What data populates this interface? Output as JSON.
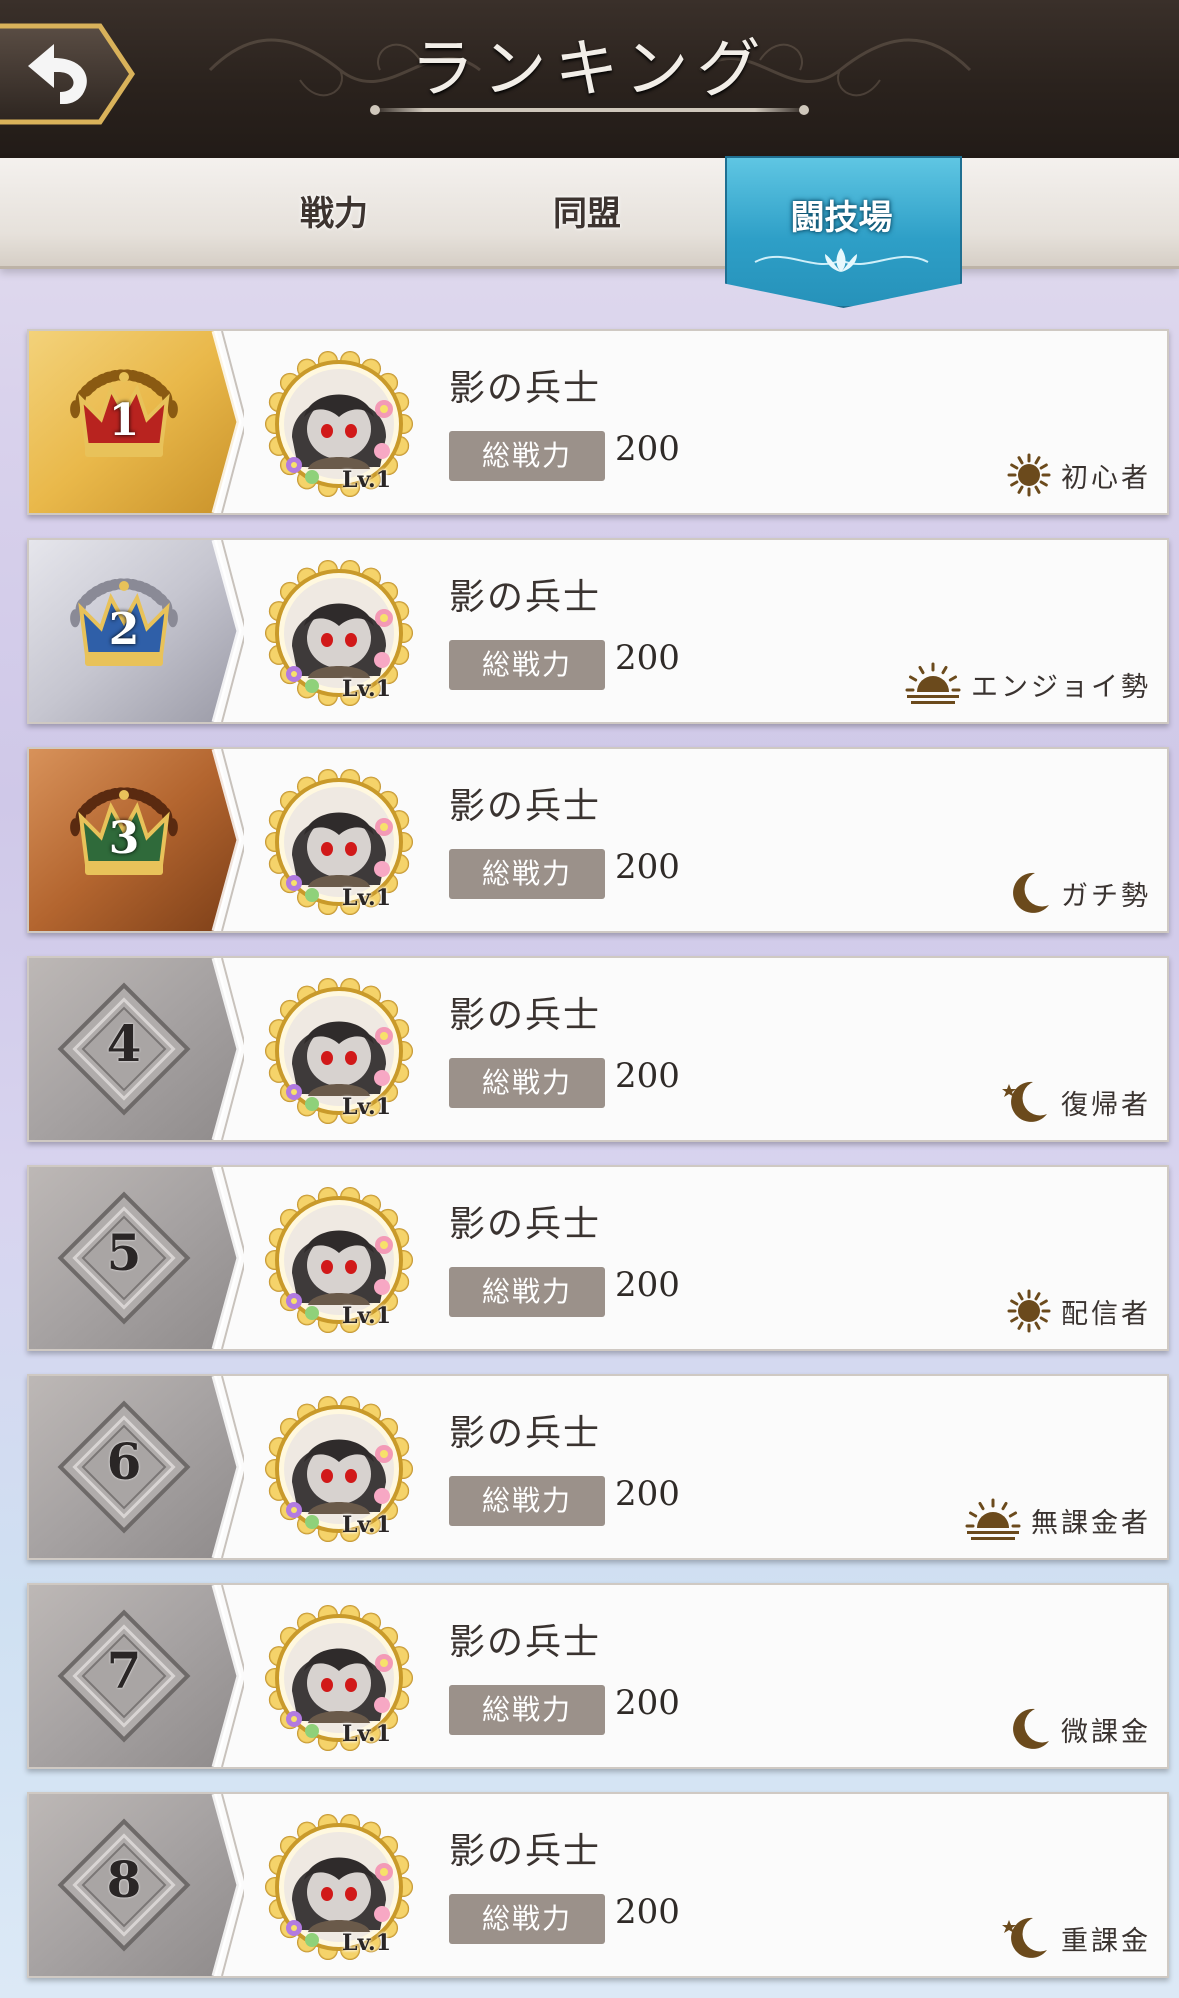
{
  "header": {
    "title": "ランキング",
    "back_icon": "back-arrow-icon"
  },
  "tabs": [
    {
      "label": "戦力",
      "active": false
    },
    {
      "label": "同盟",
      "active": false
    },
    {
      "label": "闘技場",
      "active": true
    }
  ],
  "colors": {
    "accent": "#2e9fc7",
    "gold": "#e8b93a",
    "silver": "#b9b9c3",
    "bronze": "#b3652f",
    "power_label_bg": "#9b918a"
  },
  "power_label": "総戦力",
  "level_badge": "Lv.1",
  "rankings": [
    {
      "rank": "1",
      "name": "影の兵士",
      "power": "200",
      "status": "初心者",
      "status_icon": "sun-icon",
      "medal": "gold-crown-icon"
    },
    {
      "rank": "2",
      "name": "影の兵士",
      "power": "200",
      "status": "エンジョイ勢",
      "status_icon": "sunset-icon",
      "medal": "silver-crown-icon"
    },
    {
      "rank": "3",
      "name": "影の兵士",
      "power": "200",
      "status": "ガチ勢",
      "status_icon": "crescent-moon-icon",
      "medal": "bronze-crown-icon"
    },
    {
      "rank": "4",
      "name": "影の兵士",
      "power": "200",
      "status": "復帰者",
      "status_icon": "moon-stars-icon"
    },
    {
      "rank": "5",
      "name": "影の兵士",
      "power": "200",
      "status": "配信者",
      "status_icon": "sun-icon"
    },
    {
      "rank": "6",
      "name": "影の兵士",
      "power": "200",
      "status": "無課金者",
      "status_icon": "sunset-icon"
    },
    {
      "rank": "7",
      "name": "影の兵士",
      "power": "200",
      "status": "微課金",
      "status_icon": "crescent-moon-icon"
    },
    {
      "rank": "8",
      "name": "影の兵士",
      "power": "200",
      "status": "重課金",
      "status_icon": "moon-stars-icon"
    }
  ]
}
